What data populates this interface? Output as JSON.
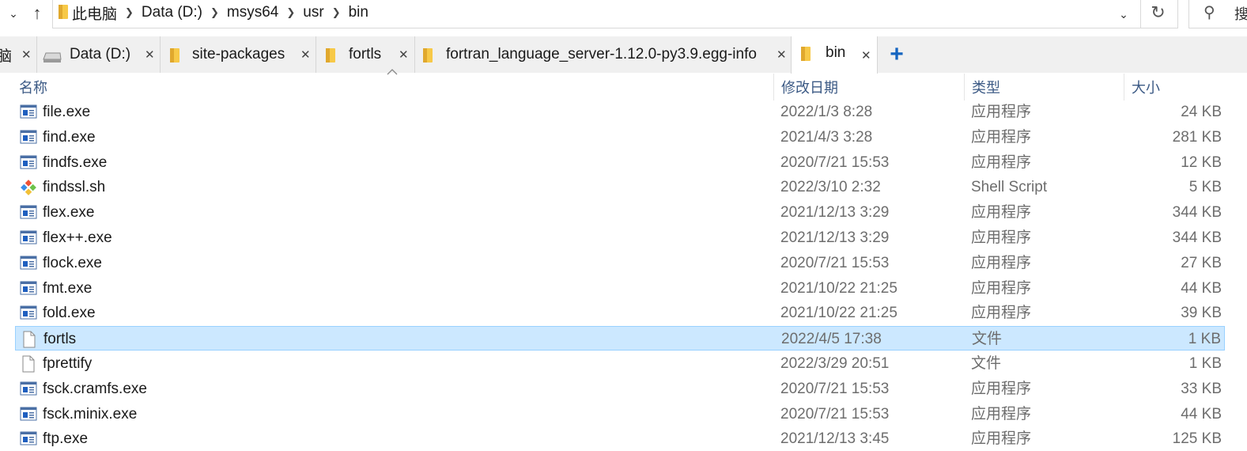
{
  "address": {
    "breadcrumb": [
      "此电脑",
      "Data (D:)",
      "msys64",
      "usr",
      "bin"
    ],
    "search_placeholder_fragment": "搜"
  },
  "tabs": [
    {
      "label": "脑",
      "icon": "pc-icon",
      "active": false
    },
    {
      "label": "Data (D:)",
      "icon": "drive-icon",
      "active": false
    },
    {
      "label": "site-packages",
      "icon": "folder-icon",
      "active": false
    },
    {
      "label": "fortls",
      "icon": "folder-icon",
      "active": false
    },
    {
      "label": "fortran_language_server-1.12.0-py3.9.egg-info",
      "icon": "folder-icon",
      "active": false
    },
    {
      "label": "bin",
      "icon": "folder-icon",
      "active": true
    }
  ],
  "columns": {
    "name": "名称",
    "date": "修改日期",
    "type": "类型",
    "size": "大小"
  },
  "files": [
    {
      "name": "file.exe",
      "date": "2022/1/3 8:28",
      "type": "应用程序",
      "size": "24 KB",
      "icon": "exe-icon"
    },
    {
      "name": "find.exe",
      "date": "2021/4/3 3:28",
      "type": "应用程序",
      "size": "281 KB",
      "icon": "exe-icon"
    },
    {
      "name": "findfs.exe",
      "date": "2020/7/21 15:53",
      "type": "应用程序",
      "size": "12 KB",
      "icon": "exe-icon"
    },
    {
      "name": "findssl.sh",
      "date": "2022/3/10 2:32",
      "type": "Shell Script",
      "size": "5 KB",
      "icon": "shell-script-icon"
    },
    {
      "name": "flex.exe",
      "date": "2021/12/13 3:29",
      "type": "应用程序",
      "size": "344 KB",
      "icon": "exe-icon"
    },
    {
      "name": "flex++.exe",
      "date": "2021/12/13 3:29",
      "type": "应用程序",
      "size": "344 KB",
      "icon": "exe-icon"
    },
    {
      "name": "flock.exe",
      "date": "2020/7/21 15:53",
      "type": "应用程序",
      "size": "27 KB",
      "icon": "exe-icon"
    },
    {
      "name": "fmt.exe",
      "date": "2021/10/22 21:25",
      "type": "应用程序",
      "size": "44 KB",
      "icon": "exe-icon"
    },
    {
      "name": "fold.exe",
      "date": "2021/10/22 21:25",
      "type": "应用程序",
      "size": "39 KB",
      "icon": "exe-icon"
    },
    {
      "name": "fortls",
      "date": "2022/4/5 17:38",
      "type": "文件",
      "size": "1 KB",
      "icon": "file-icon",
      "selected": true
    },
    {
      "name": "fprettify",
      "date": "2022/3/29 20:51",
      "type": "文件",
      "size": "1 KB",
      "icon": "file-icon"
    },
    {
      "name": "fsck.cramfs.exe",
      "date": "2020/7/21 15:53",
      "type": "应用程序",
      "size": "33 KB",
      "icon": "exe-icon"
    },
    {
      "name": "fsck.minix.exe",
      "date": "2020/7/21 15:53",
      "type": "应用程序",
      "size": "44 KB",
      "icon": "exe-icon"
    },
    {
      "name": "ftp.exe",
      "date": "2021/12/13 3:45",
      "type": "应用程序",
      "size": "125 KB",
      "icon": "exe-icon"
    }
  ],
  "colors": {
    "selection_bg": "#cce8ff",
    "selection_border": "#99d1ff",
    "header_text": "#3c5a85",
    "accent": "#1565c0"
  }
}
